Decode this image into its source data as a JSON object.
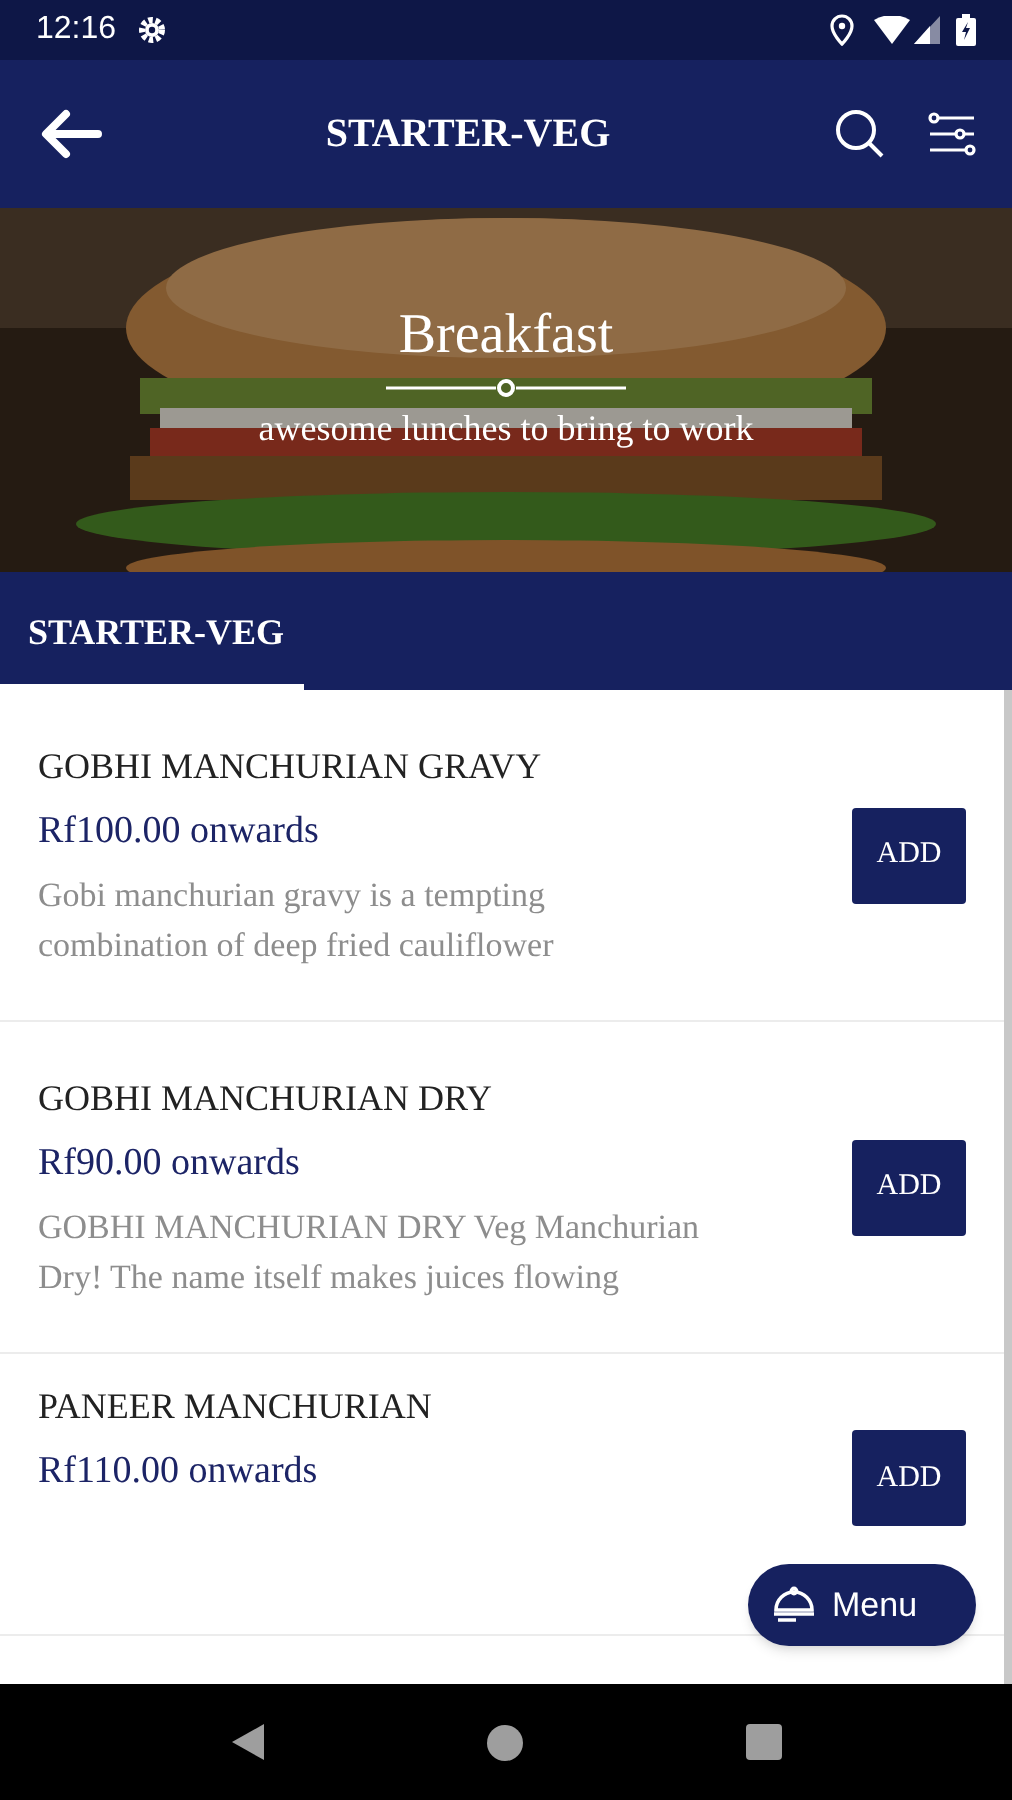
{
  "status_bar": {
    "time": "12:16"
  },
  "app_bar": {
    "title": "STARTER-VEG"
  },
  "banner": {
    "kind": "picture",
    "title": "Breakfast",
    "subtitle": "awesome lunches to bring to work"
  },
  "tabs": [
    {
      "label": "STARTER-VEG",
      "selected": true
    }
  ],
  "items": [
    {
      "name": "GOBHI MANCHURIAN GRAVY",
      "price": "Rf100.00 onwards",
      "description": "Gobi manchurian gravy is a tempting combination of deep fried cauliflower",
      "button": "ADD"
    },
    {
      "name": "GOBHI MANCHURIAN DRY",
      "price": "Rf90.00 onwards",
      "description": "GOBHI MANCHURIAN DRY Veg Manchurian Dry! The name itself makes juices flowing",
      "button": "ADD"
    },
    {
      "name": "PANEER MANCHURIAN",
      "price": "Rf110.00 onwards",
      "button": "ADD"
    }
  ],
  "menu_button": {
    "label": "Menu"
  }
}
